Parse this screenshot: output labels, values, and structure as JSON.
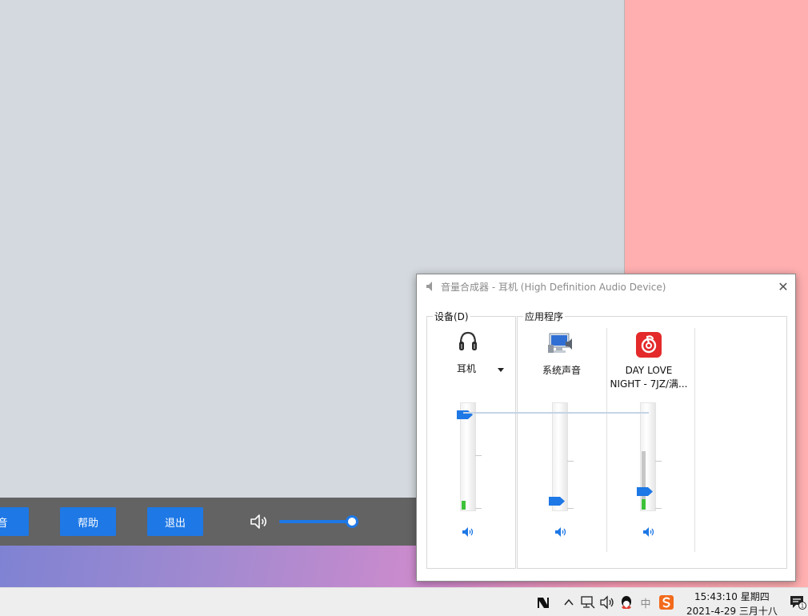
{
  "app": {
    "buttons": {
      "partial_label": "音",
      "help_label": "帮助",
      "exit_label": "退出"
    },
    "volume_level": 0.91,
    "accent_color": "#1e78e6"
  },
  "mixer": {
    "title": "音量合成器 - 耳机 (High Definition Audio Device)",
    "close_glyph": "✕",
    "devices_group": {
      "label": "设备(D)",
      "device_name": "耳机",
      "volume_level": 0.92,
      "meter_level": 0.08,
      "icon": "headphones-icon"
    },
    "apps_group": {
      "label": "应用程序",
      "apps": [
        {
          "name": "系统声音",
          "icon": "system-sounds-icon",
          "volume_level": 0.06,
          "meter_level": 0.0
        },
        {
          "name": "DAY LOVE NIGHT - 7JZ/满...",
          "name_line1": "DAY LOVE",
          "name_line2": "NIGHT - 7JZ/满...",
          "icon": "netease-music-icon",
          "volume_level": 0.15,
          "meter_level": 0.55,
          "meter_green": 0.1
        }
      ]
    },
    "mute_icon": "speaker-volume-icon"
  },
  "taskbar": {
    "time": "15:43:10 星期四",
    "date": "2021-4-29 三月十八",
    "ime_label": "中",
    "notification_count": "1"
  }
}
